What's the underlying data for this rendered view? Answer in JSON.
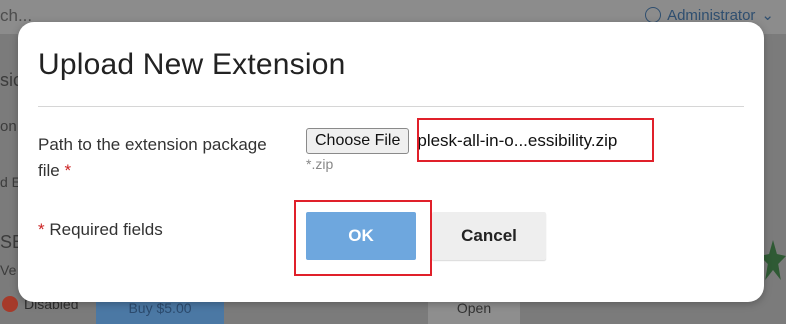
{
  "background": {
    "search_fragment": "ch...",
    "user_name": "Administrator",
    "fragments": [
      "sic",
      "on",
      "d E",
      "SE",
      "Ve"
    ],
    "status_label": "Disabled",
    "buy_label": "Buy $5.00",
    "open_label": "Open"
  },
  "dialog": {
    "title": "Upload New Extension",
    "path_label": "Path to the extension package file",
    "required_star": "*",
    "choose_file_label": "Choose File",
    "file_name": "plesk-all-in-o...essibility.zip",
    "file_hint": "*.zip",
    "required_note": "Required fields",
    "ok_label": "OK",
    "cancel_label": "Cancel"
  },
  "colors": {
    "highlight": "#e0202a",
    "ok_button": "#6ea7de",
    "cancel_button": "#eeeeee"
  }
}
